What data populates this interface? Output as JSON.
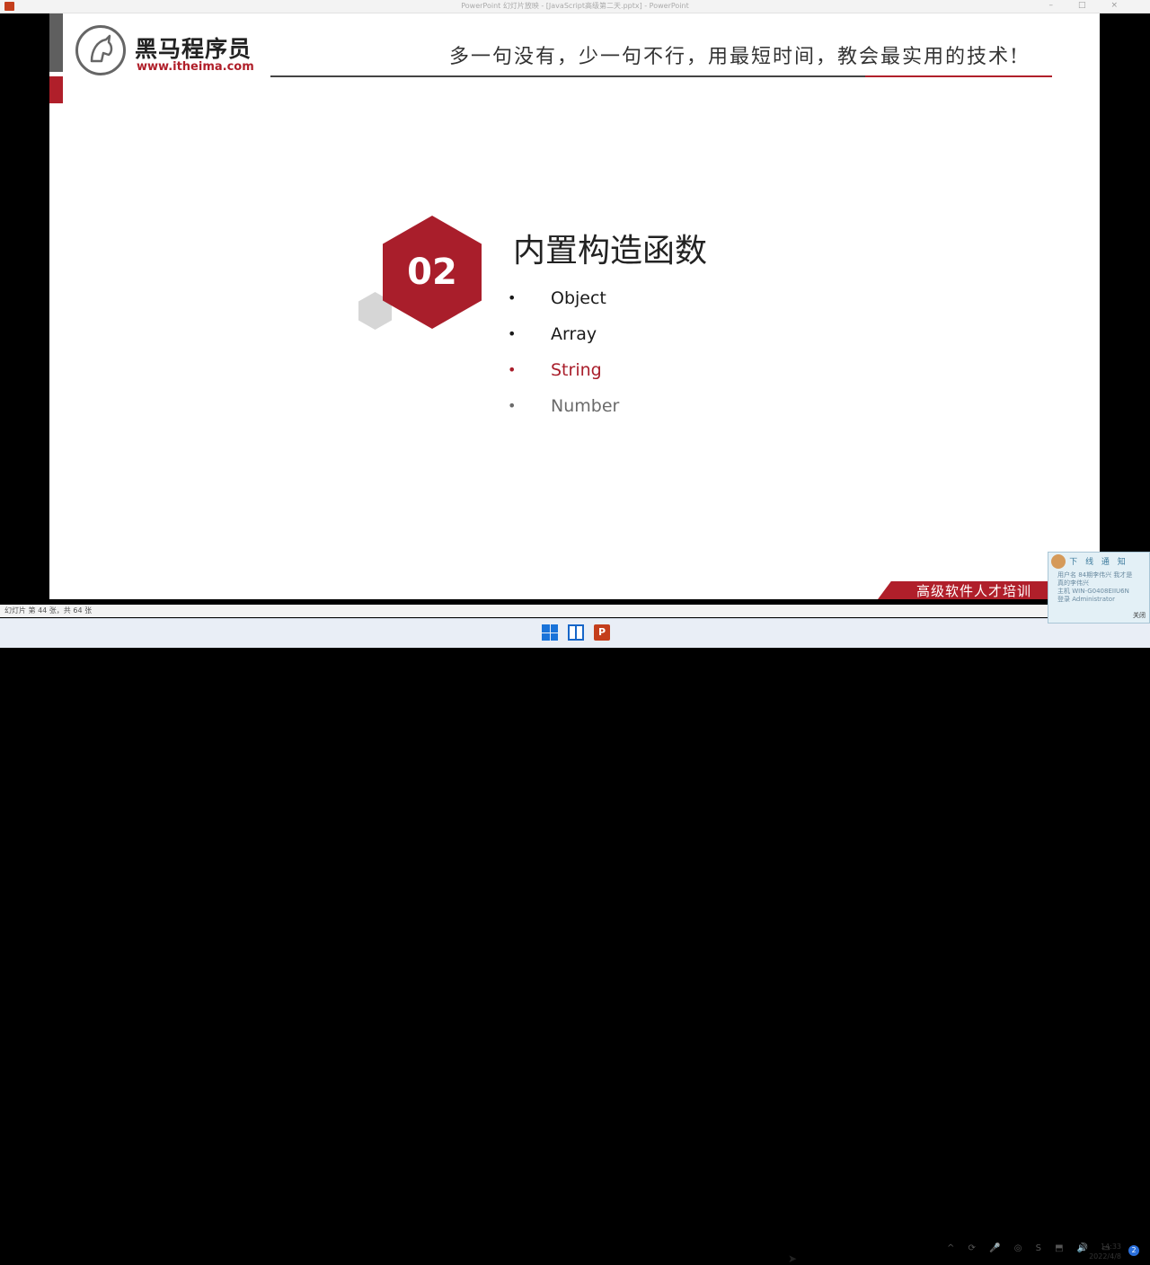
{
  "window": {
    "title": "PowerPoint 幻灯片放映 - [JavaScript高级第二天.pptx] - PowerPoint",
    "controls": [
      "–",
      "□",
      "×"
    ]
  },
  "header": {
    "brand_cn": "黑马程序员",
    "brand_url": "www.itheima.com",
    "slogan": "多一句没有，少一句不行，用最短时间，教会最实用的技术!"
  },
  "section": {
    "number": "02",
    "title": "内置构造函数",
    "bullets": [
      {
        "dot": "•",
        "text": "Object",
        "color": "#1a1a1a"
      },
      {
        "dot": "•",
        "text": "Array",
        "color": "#1a1a1a"
      },
      {
        "dot": "•",
        "text": "String",
        "color": "#a91e2b"
      },
      {
        "dot": "•",
        "text": "Number",
        "color": "#6b6b6b"
      }
    ]
  },
  "footer": {
    "text": "高级软件人才培训"
  },
  "status": {
    "slide_info": "幻灯片 第 44 张，共 64 张"
  },
  "taskbar": {
    "ppt_label": "P",
    "tray": "^ ⟳ 🎤 ◎ S ⬒ 🔊 ▭",
    "time": "14:33",
    "date": "2022/4/8",
    "notifications": "2"
  },
  "popup": {
    "heading": "下 线 通 知",
    "lines": [
      "用户名 84期李伟兴 我才是",
      "真的李伟兴",
      "主机 WIN-G0408EIIU6N",
      "登录 Administrator"
    ],
    "close_label": "关闭"
  },
  "colors": {
    "accent": "#a91e2b",
    "text": "#222222"
  }
}
